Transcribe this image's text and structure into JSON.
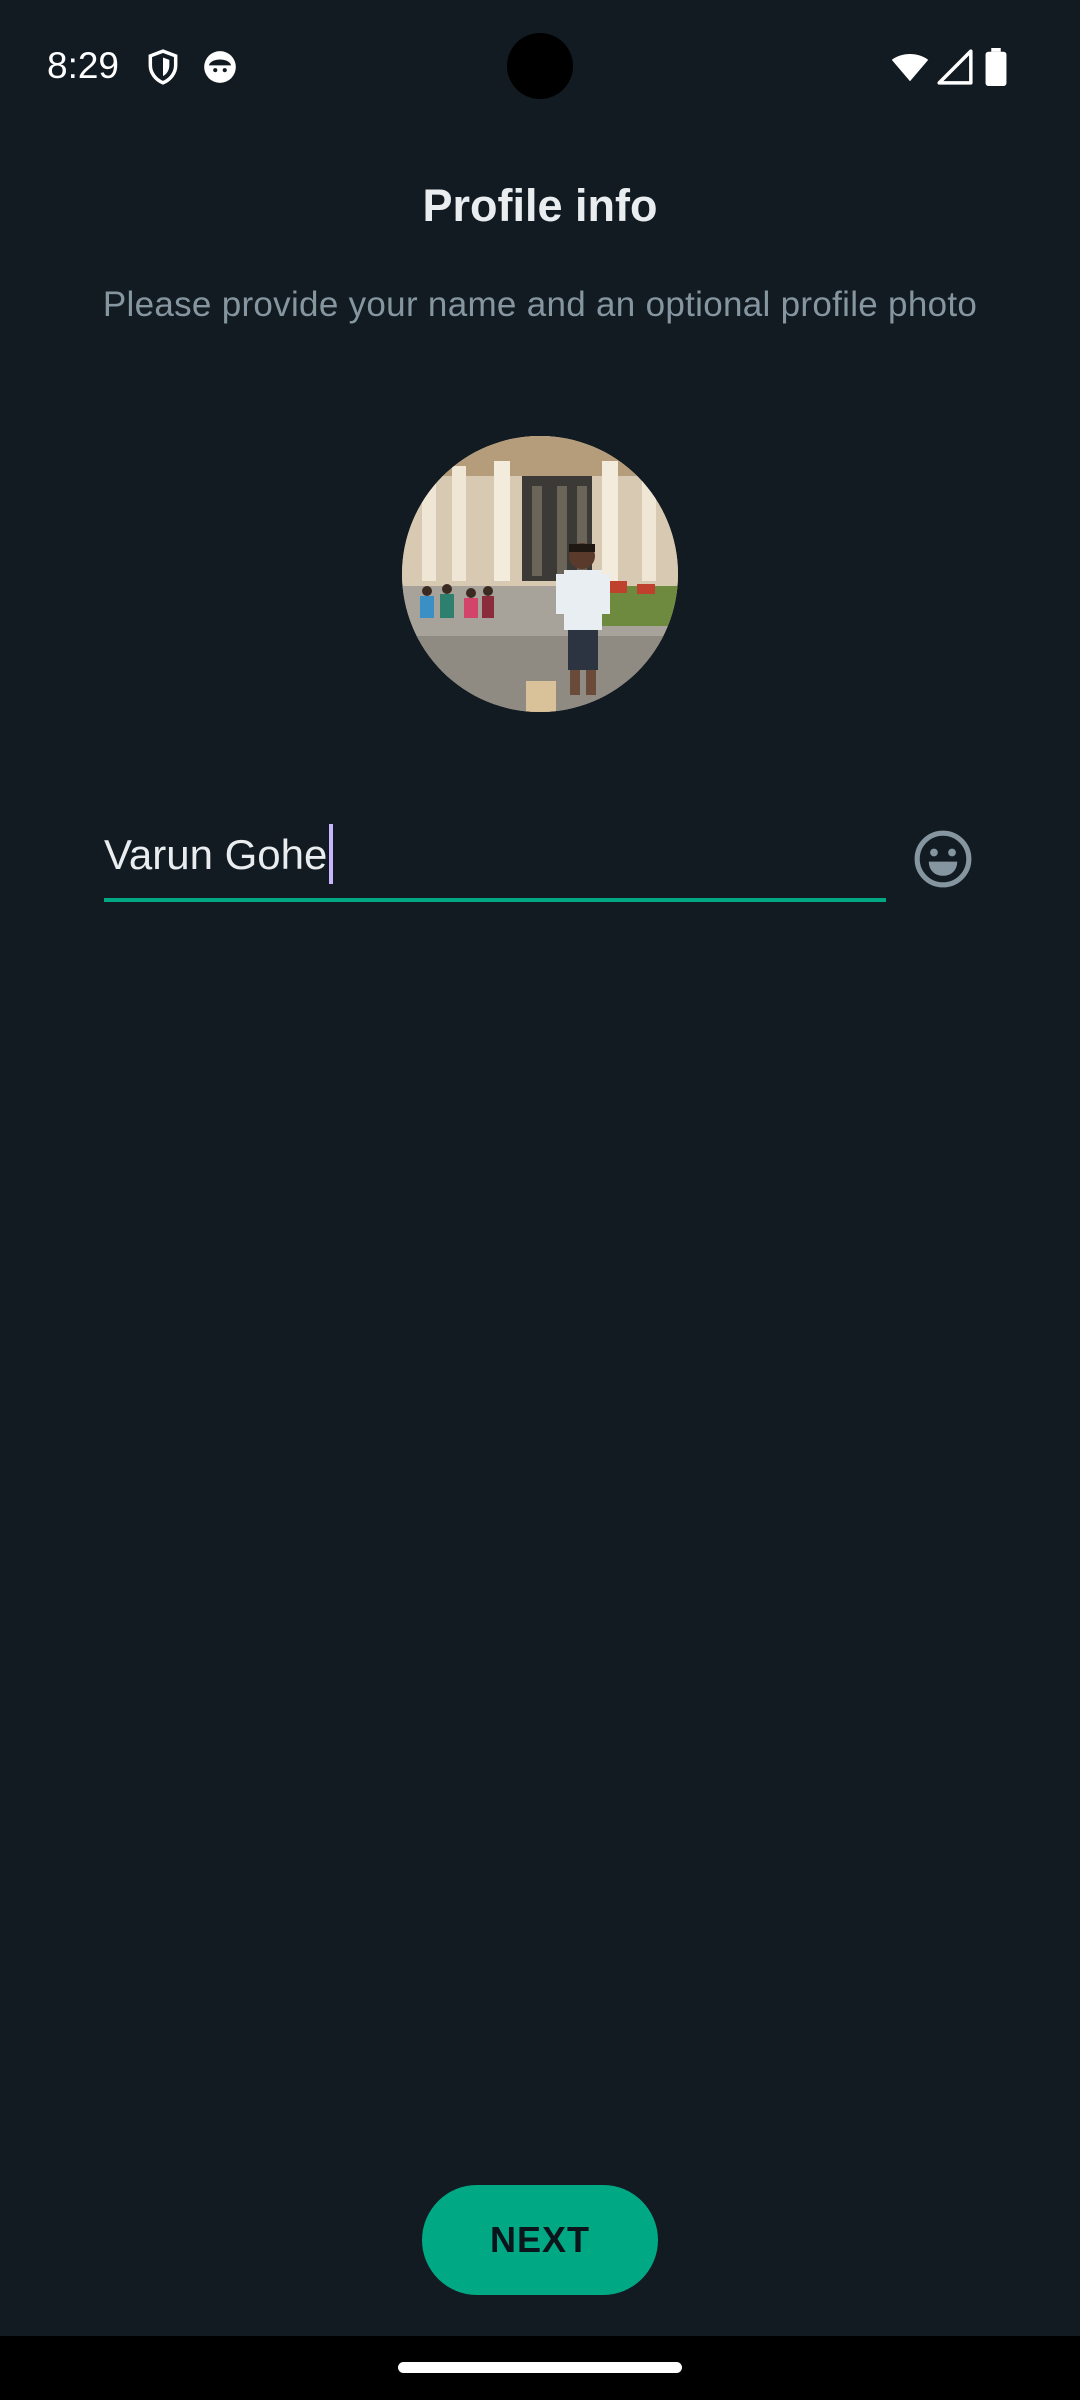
{
  "status_bar": {
    "time": "8:29",
    "icons": [
      "shield-icon",
      "cat-face-icon",
      "wifi-icon",
      "cell-signal-icon",
      "battery-icon"
    ]
  },
  "header": {
    "title": "Profile info",
    "subtitle": "Please provide your name and an optional profile photo"
  },
  "profile": {
    "photo_icon": "profile-photo"
  },
  "name_input": {
    "value": "Varun Gohe",
    "emoji_icon": "emoji-icon"
  },
  "footer": {
    "next_label": "NEXT"
  },
  "colors": {
    "background": "#121b22",
    "accent": "#00a884",
    "text_primary": "#e9edef",
    "text_secondary": "#8696a0",
    "caret": "#c9b4ff"
  }
}
